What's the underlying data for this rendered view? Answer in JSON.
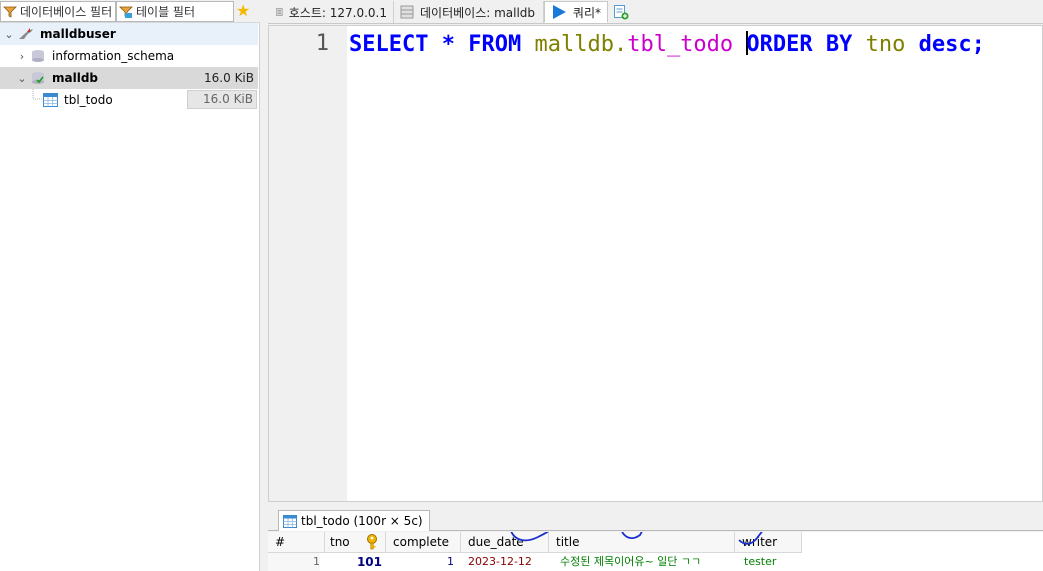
{
  "filters": {
    "database_placeholder": "데이터베이스 필터",
    "table_placeholder": "테이블 필터"
  },
  "tree": {
    "session": "malldbuser",
    "databases": [
      {
        "name": "information_schema",
        "size": ""
      },
      {
        "name": "malldb",
        "size": "16.0 KiB"
      }
    ],
    "tables": [
      {
        "name": "tbl_todo",
        "size": "16.0 KiB"
      }
    ]
  },
  "tabs": {
    "host": "호스트: 127.0.0.1",
    "database": "데이터베이스: malldb",
    "query": "쿼리*"
  },
  "editor": {
    "line_number": "1",
    "tokens": [
      "SELECT",
      "*",
      "FROM",
      "malldb",
      ".",
      "tbl_todo",
      "ORDER",
      "BY",
      "tno",
      "desc",
      ";"
    ]
  },
  "result": {
    "tab_label": "tbl_todo (100r × 5c)",
    "columns": [
      "#",
      "tno",
      "complete",
      "due_date",
      "title",
      "writer"
    ],
    "rows": [
      {
        "index": "1",
        "tno": "101",
        "complete": "1",
        "due_date": "2023-12-12",
        "title": "수정된 제목이어유~ 일단 ㄱㄱ",
        "writer": "tester"
      }
    ]
  },
  "colors": {
    "keyword": "#0000ff",
    "identifier": "#808000",
    "table_name": "#cc00cc",
    "date_value": "#8b0000",
    "text_value": "#008000",
    "annotation": "#1a2fd0"
  }
}
